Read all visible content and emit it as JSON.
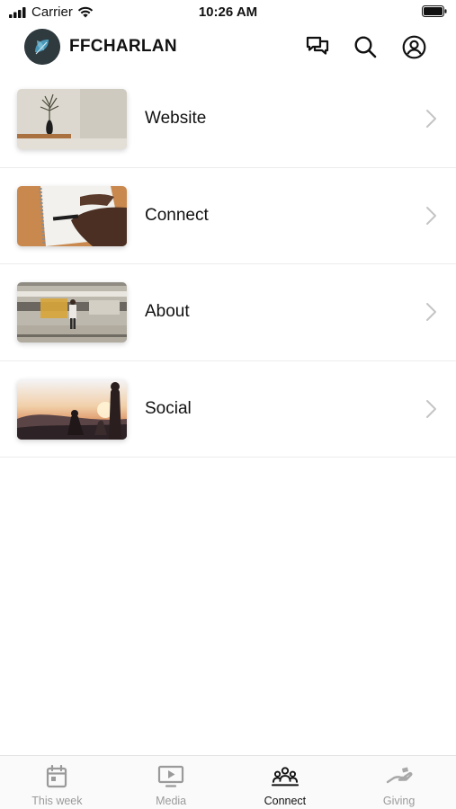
{
  "status_bar": {
    "carrier": "Carrier",
    "time": "10:26 AM"
  },
  "header": {
    "title": "FFCHARLAN",
    "icons": [
      "chat-bubbles-icon",
      "search-icon",
      "profile-icon"
    ]
  },
  "list": {
    "items": [
      {
        "label": "Website",
        "thumbnail": "vase-with-dried-flower"
      },
      {
        "label": "Connect",
        "thumbnail": "hand-writing-in-notebook"
      },
      {
        "label": "About",
        "thumbnail": "person-by-moving-train"
      },
      {
        "label": "Social",
        "thumbnail": "people-at-sunset"
      }
    ]
  },
  "tab_bar": {
    "tabs": [
      {
        "label": "This week",
        "icon": "calendar-icon",
        "active": false
      },
      {
        "label": "Media",
        "icon": "play-screen-icon",
        "active": false
      },
      {
        "label": "Connect",
        "icon": "group-icon",
        "active": true
      },
      {
        "label": "Giving",
        "icon": "giving-hand-icon",
        "active": false
      }
    ]
  },
  "colors": {
    "text": "#111111",
    "inactive_tab": "#9a9a9a",
    "divider": "#ececec",
    "logo_bg": "#2f3a3f",
    "logo_accent": "#4ea3c7"
  }
}
